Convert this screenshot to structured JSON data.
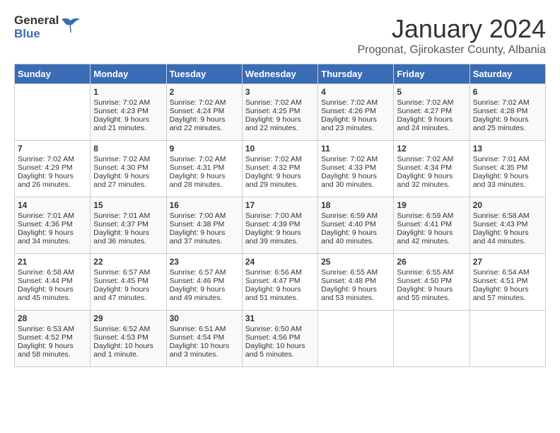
{
  "header": {
    "logo_general": "General",
    "logo_blue": "Blue",
    "month_title": "January 2024",
    "subtitle": "Progonat, Gjirokaster County, Albania"
  },
  "days_of_week": [
    "Sunday",
    "Monday",
    "Tuesday",
    "Wednesday",
    "Thursday",
    "Friday",
    "Saturday"
  ],
  "weeks": [
    [
      {
        "day": "",
        "sunrise": "",
        "sunset": "",
        "daylight": ""
      },
      {
        "day": "1",
        "sunrise": "Sunrise: 7:02 AM",
        "sunset": "Sunset: 4:23 PM",
        "daylight": "Daylight: 9 hours and 21 minutes."
      },
      {
        "day": "2",
        "sunrise": "Sunrise: 7:02 AM",
        "sunset": "Sunset: 4:24 PM",
        "daylight": "Daylight: 9 hours and 22 minutes."
      },
      {
        "day": "3",
        "sunrise": "Sunrise: 7:02 AM",
        "sunset": "Sunset: 4:25 PM",
        "daylight": "Daylight: 9 hours and 22 minutes."
      },
      {
        "day": "4",
        "sunrise": "Sunrise: 7:02 AM",
        "sunset": "Sunset: 4:26 PM",
        "daylight": "Daylight: 9 hours and 23 minutes."
      },
      {
        "day": "5",
        "sunrise": "Sunrise: 7:02 AM",
        "sunset": "Sunset: 4:27 PM",
        "daylight": "Daylight: 9 hours and 24 minutes."
      },
      {
        "day": "6",
        "sunrise": "Sunrise: 7:02 AM",
        "sunset": "Sunset: 4:28 PM",
        "daylight": "Daylight: 9 hours and 25 minutes."
      }
    ],
    [
      {
        "day": "7",
        "sunrise": "Sunrise: 7:02 AM",
        "sunset": "Sunset: 4:29 PM",
        "daylight": "Daylight: 9 hours and 26 minutes."
      },
      {
        "day": "8",
        "sunrise": "Sunrise: 7:02 AM",
        "sunset": "Sunset: 4:30 PM",
        "daylight": "Daylight: 9 hours and 27 minutes."
      },
      {
        "day": "9",
        "sunrise": "Sunrise: 7:02 AM",
        "sunset": "Sunset: 4:31 PM",
        "daylight": "Daylight: 9 hours and 28 minutes."
      },
      {
        "day": "10",
        "sunrise": "Sunrise: 7:02 AM",
        "sunset": "Sunset: 4:32 PM",
        "daylight": "Daylight: 9 hours and 29 minutes."
      },
      {
        "day": "11",
        "sunrise": "Sunrise: 7:02 AM",
        "sunset": "Sunset: 4:33 PM",
        "daylight": "Daylight: 9 hours and 30 minutes."
      },
      {
        "day": "12",
        "sunrise": "Sunrise: 7:02 AM",
        "sunset": "Sunset: 4:34 PM",
        "daylight": "Daylight: 9 hours and 32 minutes."
      },
      {
        "day": "13",
        "sunrise": "Sunrise: 7:01 AM",
        "sunset": "Sunset: 4:35 PM",
        "daylight": "Daylight: 9 hours and 33 minutes."
      }
    ],
    [
      {
        "day": "14",
        "sunrise": "Sunrise: 7:01 AM",
        "sunset": "Sunset: 4:36 PM",
        "daylight": "Daylight: 9 hours and 34 minutes."
      },
      {
        "day": "15",
        "sunrise": "Sunrise: 7:01 AM",
        "sunset": "Sunset: 4:37 PM",
        "daylight": "Daylight: 9 hours and 36 minutes."
      },
      {
        "day": "16",
        "sunrise": "Sunrise: 7:00 AM",
        "sunset": "Sunset: 4:38 PM",
        "daylight": "Daylight: 9 hours and 37 minutes."
      },
      {
        "day": "17",
        "sunrise": "Sunrise: 7:00 AM",
        "sunset": "Sunset: 4:39 PM",
        "daylight": "Daylight: 9 hours and 39 minutes."
      },
      {
        "day": "18",
        "sunrise": "Sunrise: 6:59 AM",
        "sunset": "Sunset: 4:40 PM",
        "daylight": "Daylight: 9 hours and 40 minutes."
      },
      {
        "day": "19",
        "sunrise": "Sunrise: 6:59 AM",
        "sunset": "Sunset: 4:41 PM",
        "daylight": "Daylight: 9 hours and 42 minutes."
      },
      {
        "day": "20",
        "sunrise": "Sunrise: 6:58 AM",
        "sunset": "Sunset: 4:43 PM",
        "daylight": "Daylight: 9 hours and 44 minutes."
      }
    ],
    [
      {
        "day": "21",
        "sunrise": "Sunrise: 6:58 AM",
        "sunset": "Sunset: 4:44 PM",
        "daylight": "Daylight: 9 hours and 45 minutes."
      },
      {
        "day": "22",
        "sunrise": "Sunrise: 6:57 AM",
        "sunset": "Sunset: 4:45 PM",
        "daylight": "Daylight: 9 hours and 47 minutes."
      },
      {
        "day": "23",
        "sunrise": "Sunrise: 6:57 AM",
        "sunset": "Sunset: 4:46 PM",
        "daylight": "Daylight: 9 hours and 49 minutes."
      },
      {
        "day": "24",
        "sunrise": "Sunrise: 6:56 AM",
        "sunset": "Sunset: 4:47 PM",
        "daylight": "Daylight: 9 hours and 51 minutes."
      },
      {
        "day": "25",
        "sunrise": "Sunrise: 6:55 AM",
        "sunset": "Sunset: 4:48 PM",
        "daylight": "Daylight: 9 hours and 53 minutes."
      },
      {
        "day": "26",
        "sunrise": "Sunrise: 6:55 AM",
        "sunset": "Sunset: 4:50 PM",
        "daylight": "Daylight: 9 hours and 55 minutes."
      },
      {
        "day": "27",
        "sunrise": "Sunrise: 6:54 AM",
        "sunset": "Sunset: 4:51 PM",
        "daylight": "Daylight: 9 hours and 57 minutes."
      }
    ],
    [
      {
        "day": "28",
        "sunrise": "Sunrise: 6:53 AM",
        "sunset": "Sunset: 4:52 PM",
        "daylight": "Daylight: 9 hours and 58 minutes."
      },
      {
        "day": "29",
        "sunrise": "Sunrise: 6:52 AM",
        "sunset": "Sunset: 4:53 PM",
        "daylight": "Daylight: 10 hours and 1 minute."
      },
      {
        "day": "30",
        "sunrise": "Sunrise: 6:51 AM",
        "sunset": "Sunset: 4:54 PM",
        "daylight": "Daylight: 10 hours and 3 minutes."
      },
      {
        "day": "31",
        "sunrise": "Sunrise: 6:50 AM",
        "sunset": "Sunset: 4:56 PM",
        "daylight": "Daylight: 10 hours and 5 minutes."
      },
      {
        "day": "",
        "sunrise": "",
        "sunset": "",
        "daylight": ""
      },
      {
        "day": "",
        "sunrise": "",
        "sunset": "",
        "daylight": ""
      },
      {
        "day": "",
        "sunrise": "",
        "sunset": "",
        "daylight": ""
      }
    ]
  ]
}
